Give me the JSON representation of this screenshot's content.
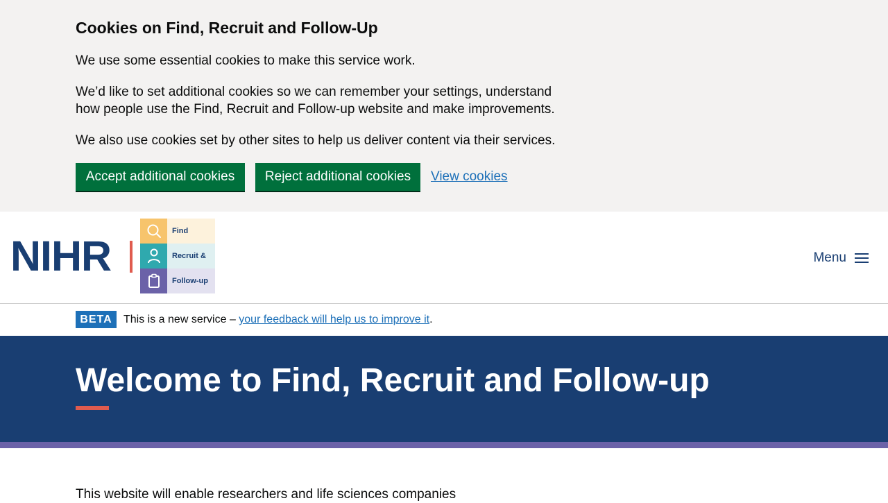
{
  "cookie_banner": {
    "title": "Cookies on Find, Recruit and Follow-Up",
    "paragraph_1": "We use some essential cookies to make this service work.",
    "paragraph_2": "We’d like to set additional cookies so we can remember your settings, understand how people use the Find, Recruit and Follow-up website and make improvements.",
    "paragraph_3": "We also use cookies set by other sites to help us deliver content via their services.",
    "accept_label": "Accept additional cookies",
    "reject_label": "Reject additional cookies",
    "view_label": "View cookies"
  },
  "header": {
    "logo_text": "NIHR",
    "tiles": [
      {
        "label": "Find",
        "icon": "search-icon"
      },
      {
        "label": "Recruit &",
        "icon": "person-icon"
      },
      {
        "label": "Follow-up",
        "icon": "clipboard-icon"
      }
    ],
    "menu_label": "Menu"
  },
  "phase_banner": {
    "tag": "BETA",
    "text_before": "This is a new service – ",
    "link_text": "your feedback will help us to improve it",
    "text_after": "."
  },
  "hero": {
    "title": "Welcome to Find, Recruit and Follow-up"
  },
  "body": {
    "intro": "This website will enable researchers and life sciences companies"
  },
  "colors": {
    "cookie_bg": "#f3f2f1",
    "button_green": "#00703c",
    "link_blue": "#1d70b8",
    "nihr_navy": "#193e72",
    "accent_coral": "#e05b4e",
    "stripe_purple": "#6b62a8"
  }
}
